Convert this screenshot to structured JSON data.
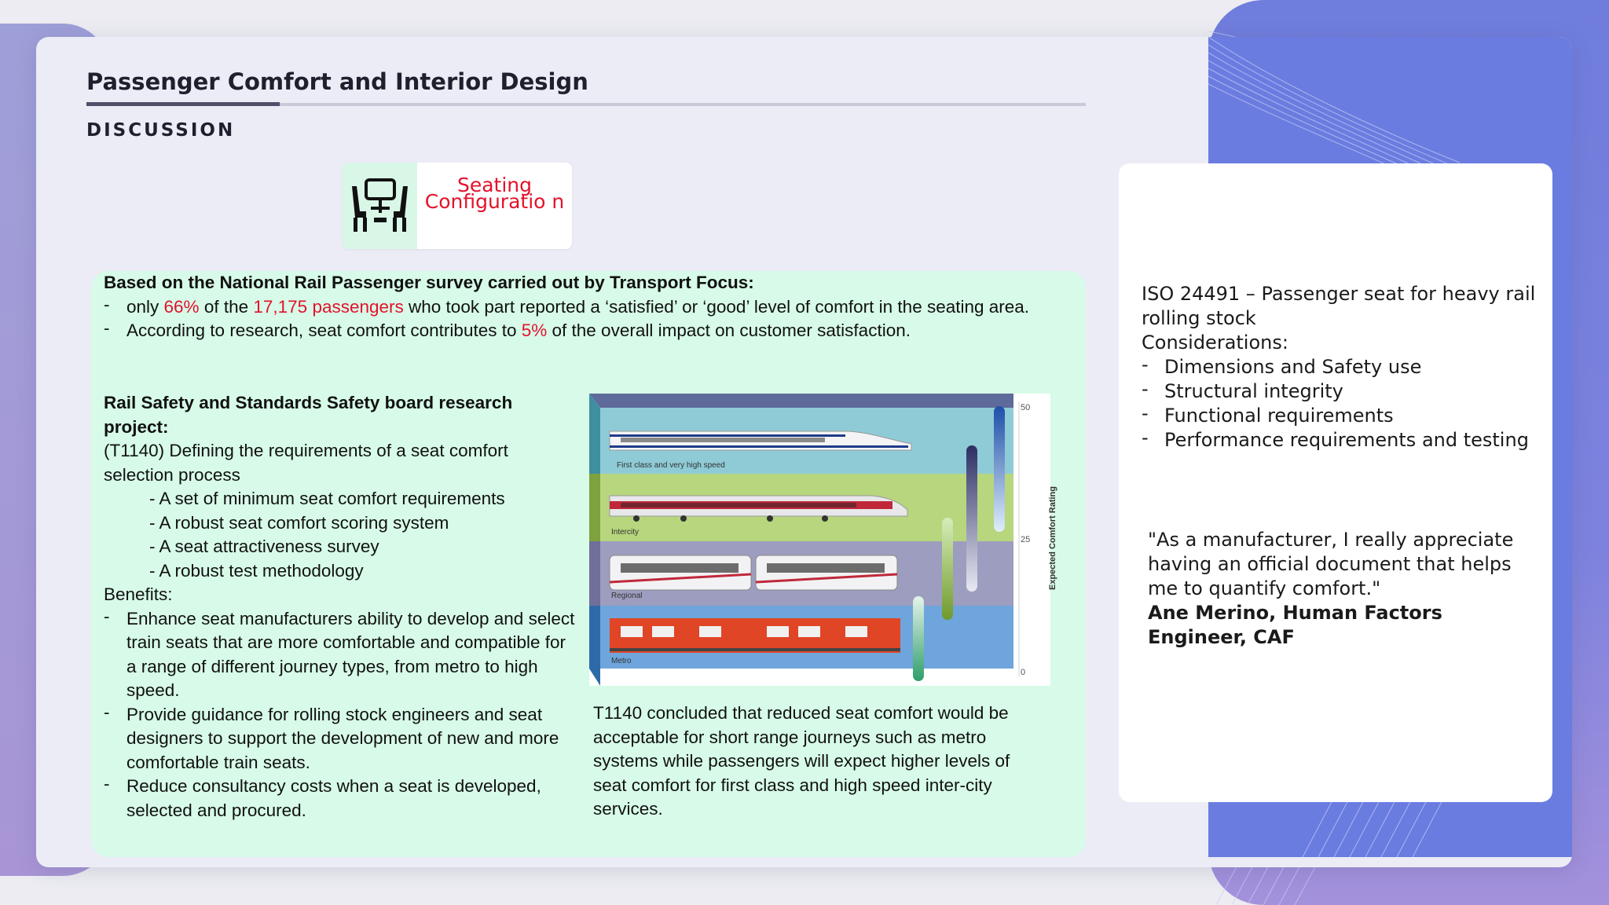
{
  "slide": {
    "title": "Passenger Comfort and Interior Design",
    "subtitle": "DISCUSSION",
    "tag": {
      "icon": "train-seating-icon",
      "label": "Seating Configuratio n"
    }
  },
  "survey": {
    "heading": "Based on the National Rail Passenger survey carried out by Transport Focus:",
    "bullet1": {
      "pre": "only ",
      "pct": "66%",
      "mid": " of the ",
      "count": "17,175 passengers",
      "post": " who took part reported a ‘satisfied’ or ‘good’ level of comfort in the seating area."
    },
    "bullet2": {
      "pre": "According to research, seat comfort contributes to ",
      "pct": "5%",
      "post": " of the overall impact on customer satisfaction."
    }
  },
  "rssb": {
    "heading": "Rail Safety and Standards Safety board research project:",
    "intro": "(T1140) Defining the requirements of a seat comfort selection process",
    "items": [
      "- A set of minimum seat comfort requirements",
      "- A robust seat comfort scoring system",
      "- A seat attractiveness survey",
      "- A robust test methodology"
    ],
    "benefits_label": "Benefits:",
    "benefits": [
      "Enhance seat manufacturers ability to develop and select train seats that are more comfortable and compatible for a range of different journey types, from metro to high speed.",
      "Provide guidance for rolling stock engineers and seat designers to support the development of new and more comfortable train seats.",
      "Reduce consultancy costs when a seat is developed, selected and procured."
    ]
  },
  "figure": {
    "axis_label": "Expected Comfort Rating",
    "ticks": [
      "50",
      "25",
      "0"
    ],
    "bands": [
      "First class and very high speed",
      "Intercity",
      "Regional",
      "Metro"
    ],
    "caption": "T1140 concluded that reduced seat comfort would be acceptable for short range journeys such as metro systems while passengers will expect higher levels of seat comfort for first class and high speed inter-city services."
  },
  "side": {
    "iso_title": "ISO 24491 – Passenger seat for heavy rail rolling stock",
    "considerations_label": "Considerations:",
    "considerations": [
      "Dimensions and Safety use",
      "Structural integrity",
      "Functional requirements",
      "Performance requirements and testing"
    ],
    "quote": "\"As a manufacturer, I really appreciate having an official document that helps me to quantify comfort.\"",
    "quote_author": "Ane Merino, Human Factors Engineer, CAF"
  },
  "colors": {
    "highlight": "#e3122b",
    "panel": "#d7fbe8",
    "accent_blue": "#6b7ce0"
  }
}
